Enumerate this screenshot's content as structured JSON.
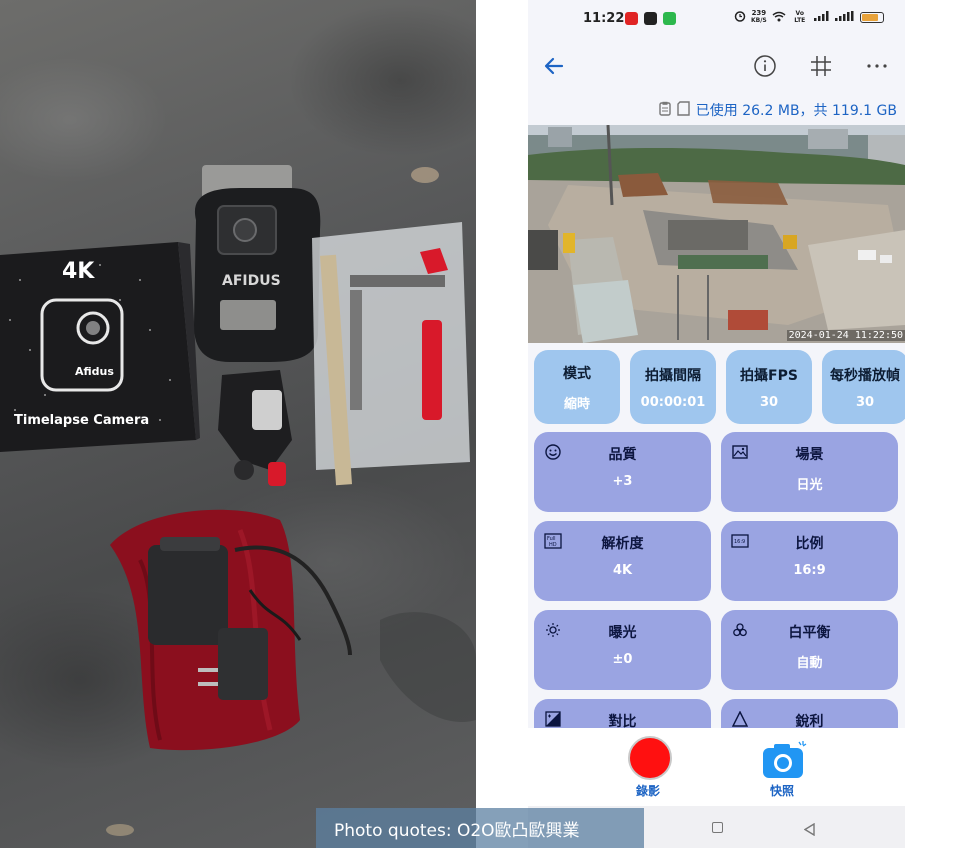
{
  "photo": {
    "box_text": [
      "4K",
      "Afidus",
      "Timelapse Camera"
    ],
    "case_text": "AFIDUS",
    "colors": {
      "velvet_bag": "#8b0f1e",
      "camera_box": "#1b1b1d",
      "clip_accent": "#d8192a"
    }
  },
  "status_bar": {
    "time": "11:22",
    "net_speed_value": "239",
    "net_speed_unit": "KB/S",
    "volte": "Vo LTE",
    "battery_level_percent": 80,
    "app_icon_colors": [
      "#e02424",
      "#222222",
      "#2db84d"
    ]
  },
  "toolbar": {
    "back_icon": "arrow-left-icon",
    "info_icon": "info-circle-icon",
    "grid_icon": "grid-hash-icon",
    "more_icon": "more-horizontal-icon"
  },
  "storage": {
    "text": "已使用 26.2 MB，共 119.1 GB"
  },
  "preview": {
    "timestamp": "2024-01-24 11:22:50"
  },
  "small_tiles": [
    {
      "label": "模式",
      "value": "縮時"
    },
    {
      "label": "拍攝間隔",
      "value": "00:00:01"
    },
    {
      "label": "拍攝FPS",
      "value": "30"
    },
    {
      "label": "每秒播放幀",
      "value": "30"
    }
  ],
  "settings": [
    {
      "label": "品質",
      "value": "+3",
      "icon": "smiley-icon"
    },
    {
      "label": "場景",
      "value": "日光",
      "icon": "landscape-image-icon"
    },
    {
      "label": "解析度",
      "value": "4K",
      "icon": "resolution-icon"
    },
    {
      "label": "比例",
      "value": "16:9",
      "icon": "aspect-ratio-icon"
    },
    {
      "label": "曝光",
      "value": "±0",
      "icon": "exposure-sun-icon"
    },
    {
      "label": "白平衡",
      "value": "自動",
      "icon": "white-balance-icon"
    },
    {
      "label": "對比",
      "value": "",
      "icon": "contrast-icon"
    },
    {
      "label": "銳利",
      "value": "",
      "icon": "sharpness-triangle-icon"
    }
  ],
  "actions": {
    "record_label": "錄影",
    "snapshot_label": "快照",
    "record_color": "#ff1010",
    "snapshot_color": "#2196f3"
  },
  "watermark": {
    "text": "Photo quotes: O2O歐凸歐興業"
  }
}
